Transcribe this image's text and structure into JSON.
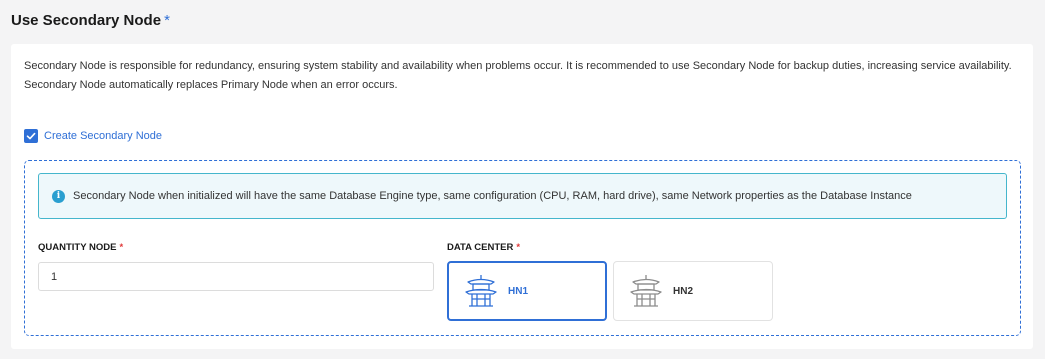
{
  "section": {
    "title": "Use Secondary Node",
    "required_mark": "*"
  },
  "description": {
    "line1": "Secondary Node is responsible for redundancy, ensuring system stability and availability when problems occur. It is recommended to use Secondary Node for backup duties, increasing service availability.",
    "line2": "Secondary Node automatically replaces Primary Node when an error occurs."
  },
  "create_secondary": {
    "label": "Create Secondary Node",
    "checked": true
  },
  "info": {
    "icon": "info-icon",
    "text": "Secondary Node when initialized will have the same Database Engine type, same configuration (CPU, RAM, hard drive), same Network properties as the Database Instance"
  },
  "quantity": {
    "label": "QUANTITY NODE",
    "required_mark": "*",
    "value": "1"
  },
  "data_center": {
    "label": "DATA CENTER",
    "required_mark": "*",
    "options": [
      {
        "label": "HN1",
        "icon": "pagoda-icon",
        "selected": true
      },
      {
        "label": "HN2",
        "icon": "pagoda-icon",
        "selected": false
      }
    ]
  },
  "colors": {
    "accent": "#2f6fd6",
    "required_red": "#e03a3a",
    "info_border": "#45b6cc",
    "info_bg": "#eef8fb"
  }
}
